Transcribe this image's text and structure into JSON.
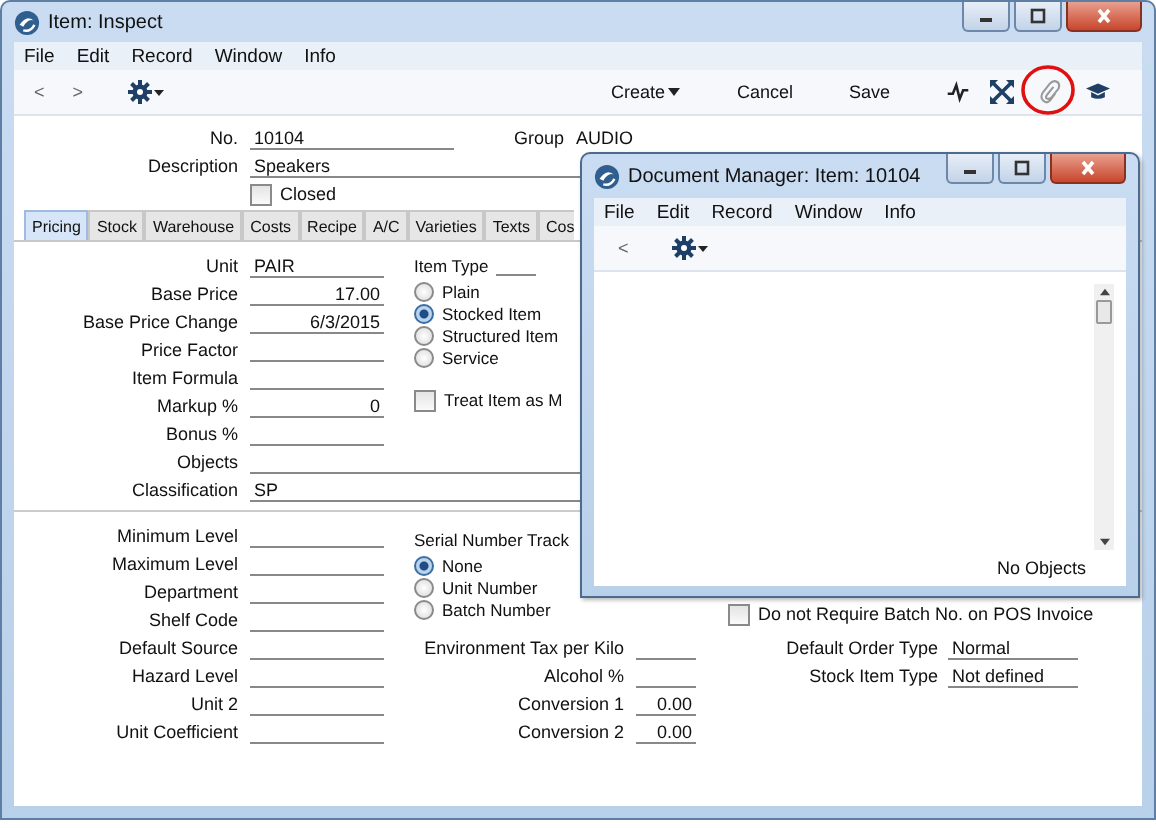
{
  "window": {
    "title": "Item: Inspect"
  },
  "menu": [
    "File",
    "Edit",
    "Record",
    "Window",
    "Info"
  ],
  "toolbar": {
    "nav": [
      "<",
      ">"
    ],
    "buttons": [
      {
        "label": "Create",
        "kind": "menu"
      },
      {
        "label": "Cancel",
        "kind": "plain"
      },
      {
        "label": "Save",
        "kind": "plain"
      }
    ]
  },
  "header": {
    "fields": [
      {
        "label": "No.",
        "value": "10104",
        "kind": "short"
      },
      {
        "label": "Description",
        "value": "Speakers",
        "kind": "long"
      }
    ],
    "closed": {
      "label": "Closed",
      "checked": false
    },
    "group": {
      "label": "Group",
      "value": "AUDIO"
    }
  },
  "tabs": [
    {
      "label": "Pricing",
      "selected": true
    },
    {
      "label": "Stock",
      "selected": false
    },
    {
      "label": "Warehouse",
      "selected": false
    },
    {
      "label": "Costs",
      "selected": false
    },
    {
      "label": "Recipe",
      "selected": false
    },
    {
      "label": "A/C",
      "selected": false
    },
    {
      "label": "Varieties",
      "selected": false
    },
    {
      "label": "Texts",
      "selected": false
    },
    {
      "label": "Cos",
      "selected": false
    }
  ],
  "pricing_fields": [
    {
      "label": "Unit",
      "value": "PAIR",
      "kind": "text"
    },
    {
      "label": "Base Price",
      "value": "17.00",
      "kind": "number"
    },
    {
      "label": "Base Price Change",
      "value": "6/3/2015",
      "kind": "number"
    },
    {
      "label": "Price Factor",
      "kind": "text"
    },
    {
      "label": "Item Formula",
      "kind": "text"
    },
    {
      "label": "Markup %",
      "value": "0",
      "kind": "number"
    },
    {
      "label": "Bonus %",
      "kind": "text"
    },
    {
      "label": "Objects",
      "kind": "wide"
    },
    {
      "label": "Classification",
      "value": "SP",
      "kind": "wide"
    }
  ],
  "item_type": {
    "label": "Item Type",
    "options": [
      {
        "label": "Plain",
        "selected": false
      },
      {
        "label": "Stocked Item",
        "selected": true
      },
      {
        "label": "Structured Item",
        "selected": false
      },
      {
        "label": "Service",
        "selected": false
      }
    ]
  },
  "treat_item": {
    "label": "Treat Item as M",
    "checked": false
  },
  "stock_fields": [
    {
      "label": "Minimum Level"
    },
    {
      "label": "Maximum Level"
    },
    {
      "label": "Department"
    },
    {
      "label": "Shelf Code"
    },
    {
      "label": "Default Source"
    },
    {
      "label": "Hazard Level"
    },
    {
      "label": "Unit 2"
    },
    {
      "label": "Unit Coefficient"
    }
  ],
  "serial_tracking": {
    "label": "Serial Number Track",
    "options": [
      {
        "label": "None",
        "selected": true
      },
      {
        "label": "Unit Number",
        "selected": false
      },
      {
        "label": "Batch Number",
        "selected": false
      }
    ]
  },
  "tax_fields": [
    {
      "label": "Environment Tax per Kilo"
    },
    {
      "label": "Alcohol %"
    },
    {
      "label": "Conversion 1",
      "value": "0.00"
    },
    {
      "label": "Conversion 2",
      "value": "0.00"
    }
  ],
  "batch_checkbox": {
    "label": "Do not Require Batch No. on POS Invoice",
    "checked": false
  },
  "order_fields": [
    {
      "label": "Default Order Type",
      "value": "Normal"
    },
    {
      "label": "Stock Item Type",
      "value": "Not defined"
    }
  ],
  "document_manager": {
    "title": "Document Manager: Item: 10104",
    "menu": [
      "File",
      "Edit",
      "Record",
      "Window",
      "Info"
    ],
    "nav": [
      "<"
    ],
    "status": "No Objects"
  }
}
